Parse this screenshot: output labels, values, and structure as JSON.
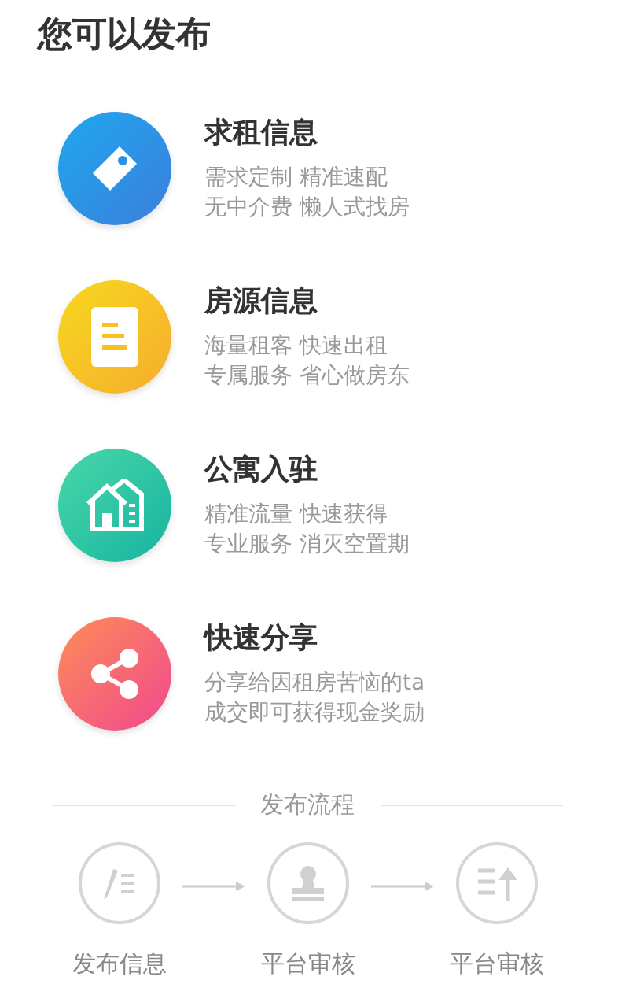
{
  "sheet": {
    "title": "您可以发布",
    "options": [
      {
        "kind": "tag",
        "title": "求租信息",
        "lines": [
          "需求定制 精准速配",
          "无中介费 懒人式找房"
        ]
      },
      {
        "kind": "document",
        "title": "房源信息",
        "lines": [
          "海量租客 快速出租",
          "专属服务 省心做房东"
        ]
      },
      {
        "kind": "houses",
        "title": "公寓入驻",
        "lines": [
          "精准流量 快速获得",
          "专业服务 消灭空置期"
        ]
      },
      {
        "kind": "share",
        "title": "快速分享",
        "lines": [
          "分享给因租房苦恼的ta",
          "成交即可获得现金奖励"
        ]
      }
    ],
    "process": {
      "title": "发布流程",
      "steps": [
        {
          "kind": "edit",
          "label": "发布信息"
        },
        {
          "kind": "stamp",
          "label": "平台审核"
        },
        {
          "kind": "upload",
          "label": "平台审核"
        }
      ]
    }
  }
}
